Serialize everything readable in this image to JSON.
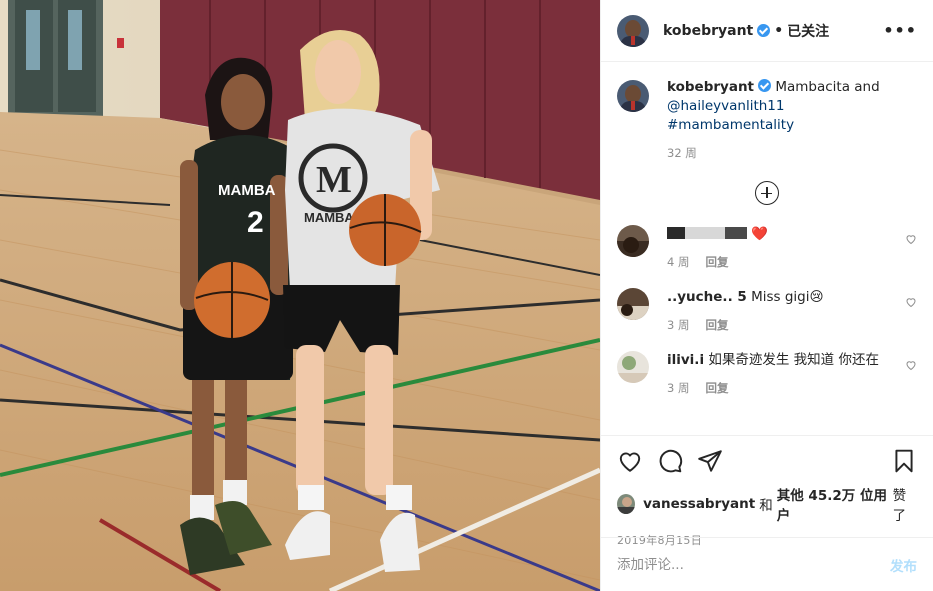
{
  "header": {
    "username": "kobebryant",
    "separator": "•",
    "follow_label": "已关注",
    "more_label": "•••"
  },
  "caption": {
    "username": "kobebryant",
    "text": "Mambacita and",
    "mention": "@haileyvanlith11",
    "hashtag": "#mambamentality",
    "time": "32 周"
  },
  "comments": [
    {
      "text": "",
      "emoji": "❤️",
      "time": "4 周",
      "reply_label": "回复"
    },
    {
      "username_visible": "..yuche.. 5",
      "text": "Miss gigi😢",
      "time": "3 周",
      "reply_label": "回复"
    },
    {
      "username_visible": "ilivi.i",
      "text": "如果奇迹发生 我知道 你还在",
      "time": "3 周",
      "reply_label": "回复"
    }
  ],
  "actions": {
    "liker": "vanessabryant",
    "likes_text_a": "和",
    "likes_text_b": "其他 45.2万 位用户",
    "likes_text_c": "赞了",
    "date": "2019年8月15日"
  },
  "add_comment": {
    "placeholder": "添加评论...",
    "post_label": "发布"
  },
  "colors": {
    "link": "#00376b",
    "verified": "#3897f0",
    "muted": "#8e8e8e",
    "post_disabled": "#b2dffc"
  }
}
